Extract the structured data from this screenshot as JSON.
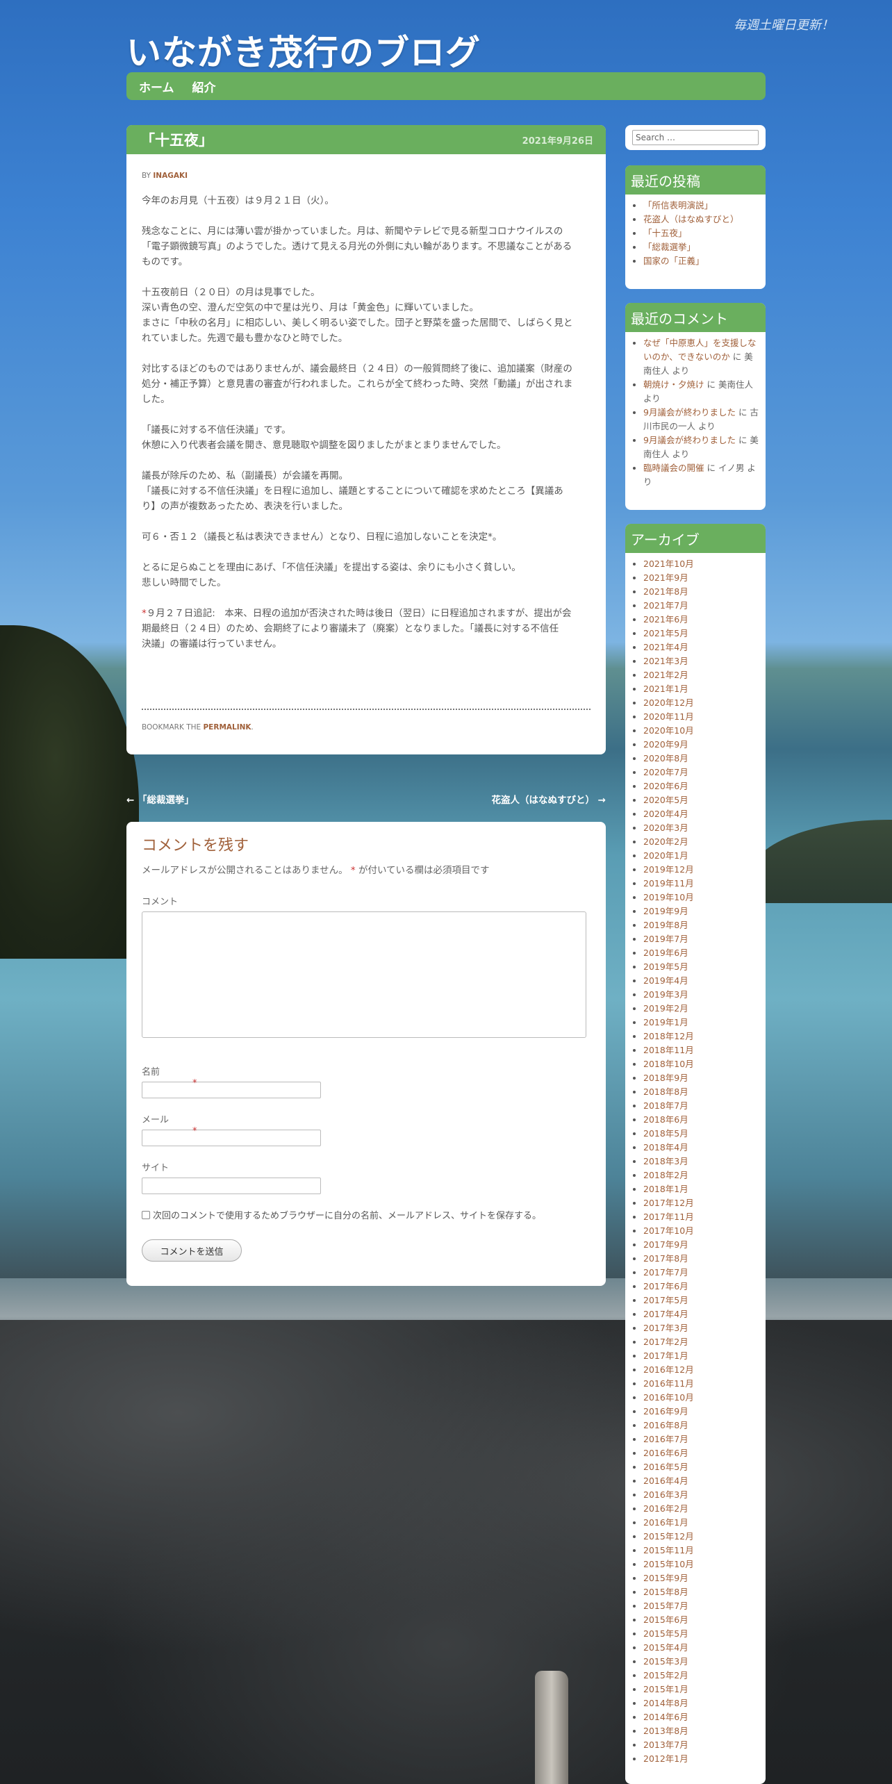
{
  "site": {
    "title": "いながき茂行のブログ",
    "description": "毎週土曜日更新！"
  },
  "nav": [
    "ホーム",
    "紹介"
  ],
  "post": {
    "title": "「十五夜」",
    "date": "2021年9月26日",
    "by_prefix": "BY ",
    "author": "INAGAKI",
    "paragraphs": [
      [
        "今年のお月見（十五夜）は９月２１日（火）。"
      ],
      [
        "残念なことに、月には薄い雲が掛かっていました。月は、新聞やテレビで見る新型コロナウイルスの",
        "「電子顕微鏡写真」のようでした。透けて見える月光の外側に丸い輪があります。不思議なことがある",
        "ものです。"
      ],
      [
        "十五夜前日（２０日）の月は見事でした。",
        "深い青色の空、澄んだ空気の中で星は光り、月は「黄金色」に輝いていました。",
        "まさに「中秋の名月」に相応しい、美しく明るい姿でした。団子と野菜を盛った居間で、しばらく見と",
        "れていました。先週で最も豊かなひと時でした。"
      ],
      [
        "対比するほどのものではありませんが、議会最終日（２４日）の一般質問終了後に、追加議案（財産の",
        "処分・補正予算）と意見書の審査が行われました。これらが全て終わった時、突然「動議」が出されま",
        "した。"
      ],
      [
        "「議長に対する不信任決議」です。",
        "休憩に入り代表者会議を開き、意見聴取や調整を図りましたがまとまりませんでした。"
      ],
      [
        "議長が除斥のため、私（副議長）が会議を再開。",
        "「議長に対する不信任決議」を日程に追加し、議題とすることについて確認を求めたところ【異議あ",
        "り】の声が複数あったため、表決を行いました。"
      ],
      [
        "可６・否１２（議長と私は表決できません）となり、日程に追加しないことを決定*。"
      ],
      [
        "とるに足らぬことを理由にあげ、「不信任決議」を提出する姿は、余りにも小さく貧しい。",
        "悲しい時間でした。"
      ]
    ],
    "footnote_mark": "*",
    "footnote": [
      "９月２７日追記:　本来、日程の追加が否決された時は後日（翌日）に日程追加されますが、提出が会",
      "期最終日（２４日）のため、会期終了により審議未了（廃案）となりました。「議長に対する不信任",
      "決議」の審議は行っていません。"
    ],
    "bookmark_prefix": "BOOKMARK THE ",
    "permalink": "PERMALINK",
    "bookmark_suffix": "."
  },
  "postnav": {
    "prev": "← 「総裁選挙」",
    "next": "花盗人（はなぬすびと） →"
  },
  "comment_form": {
    "title": "コメントを残す",
    "note_before": "メールアドレスが公開されることはありません。",
    "note_mark": "*",
    "note_after": " が付いている欄は必須項目です",
    "comment_label": "コメント",
    "name_label": "名前",
    "email_label": "メール",
    "site_label": "サイト",
    "required_mark": "*",
    "save_label": "次回のコメントで使用するためブラウザーに自分の名前、メールアドレス、サイトを保存する。",
    "submit": "コメントを送信"
  },
  "sidebar": {
    "search_placeholder": "Search …",
    "recent_posts_title": "最近の投稿",
    "recent_posts": [
      "「所信表明演説」",
      "花盗人（はなぬすびと）",
      "「十五夜」",
      "「総裁選挙」",
      "国家の「正義」"
    ],
    "recent_comments_title": "最近のコメント",
    "recent_comments": [
      {
        "link": "なぜ「中原恵人」を支援しないのか、できないのか",
        "suffix": " に 美南住人 より"
      },
      {
        "link": "朝焼け・夕焼け",
        "suffix": " に 美南住人 より"
      },
      {
        "link": "9月議会が終わりました",
        "suffix": " に 古川市民の一人 より"
      },
      {
        "link": "9月議会が終わりました",
        "suffix": " に 美南住人 より"
      },
      {
        "link": "臨時議会の開催",
        "suffix": " に イノ男 より"
      }
    ],
    "archives_title": "アーカイブ",
    "archives": [
      "2021年10月",
      "2021年9月",
      "2021年8月",
      "2021年7月",
      "2021年6月",
      "2021年5月",
      "2021年4月",
      "2021年3月",
      "2021年2月",
      "2021年1月",
      "2020年12月",
      "2020年11月",
      "2020年10月",
      "2020年9月",
      "2020年8月",
      "2020年7月",
      "2020年6月",
      "2020年5月",
      "2020年4月",
      "2020年3月",
      "2020年2月",
      "2020年1月",
      "2019年12月",
      "2019年11月",
      "2019年10月",
      "2019年9月",
      "2019年8月",
      "2019年7月",
      "2019年6月",
      "2019年5月",
      "2019年4月",
      "2019年3月",
      "2019年2月",
      "2019年1月",
      "2018年12月",
      "2018年11月",
      "2018年10月",
      "2018年9月",
      "2018年8月",
      "2018年7月",
      "2018年6月",
      "2018年5月",
      "2018年4月",
      "2018年3月",
      "2018年2月",
      "2018年1月",
      "2017年12月",
      "2017年11月",
      "2017年10月",
      "2017年9月",
      "2017年8月",
      "2017年7月",
      "2017年6月",
      "2017年5月",
      "2017年4月",
      "2017年3月",
      "2017年2月",
      "2017年1月",
      "2016年12月",
      "2016年11月",
      "2016年10月",
      "2016年9月",
      "2016年8月",
      "2016年7月",
      "2016年6月",
      "2016年5月",
      "2016年4月",
      "2016年3月",
      "2016年2月",
      "2016年1月",
      "2015年12月",
      "2015年11月",
      "2015年10月",
      "2015年9月",
      "2015年8月",
      "2015年7月",
      "2015年6月",
      "2015年5月",
      "2015年4月",
      "2015年3月",
      "2015年2月",
      "2015年1月",
      "2014年8月",
      "2014年6月",
      "2013年8月",
      "2013年7月",
      "2012年1月"
    ]
  }
}
